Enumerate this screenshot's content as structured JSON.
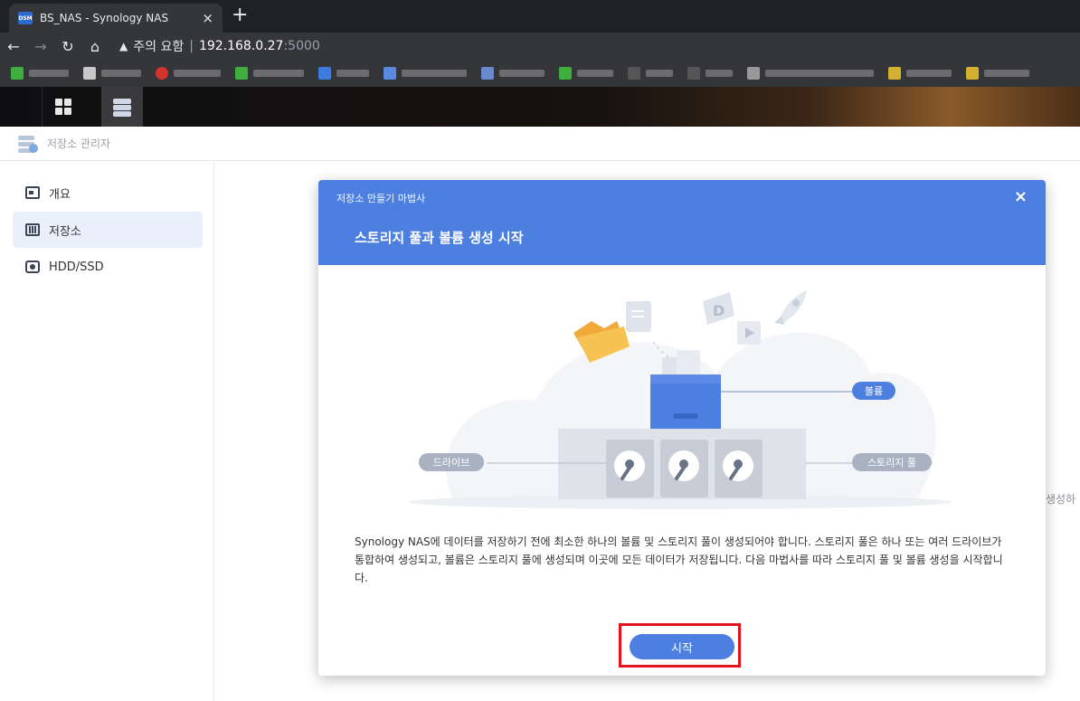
{
  "browser": {
    "tab_favicon": "DSM",
    "tab_title": "BS_NAS - Synology NAS",
    "tab_close": "×",
    "new_tab": "+",
    "warning_icon": "▲",
    "warning_text": "주의 요함",
    "separator": "|",
    "url_host": "192.168.0.27",
    "url_port": ":5000"
  },
  "app": {
    "title": "저장소 관리자"
  },
  "sidebar": {
    "items": [
      {
        "label": "개요"
      },
      {
        "label": "저장소"
      },
      {
        "label": "HDD/SSD"
      }
    ]
  },
  "background": {
    "partial_text": "생성하"
  },
  "modal": {
    "small_title": "저장소 만들기 마법사",
    "close": "×",
    "main_title": "스토리지 풀과 볼륨 생성 시작",
    "labels": {
      "volume": "볼륨",
      "drive": "드라이브",
      "storage_pool": "스토리지 풀"
    },
    "description": "Synology NAS에 데이터를 저장하기 전에 최소한 하나의 볼륨 및 스토리지 풀이 생성되어야 합니다. 스토리지 풀은 하나 또는 여러 드라이브가 통합하여 생성되고, 볼륨은 스토리지 풀에 생성되며 이곳에 모든 데이터가 저장됩니다. 다음 마법사를 따라 스토리지 풀 및 볼륨 생성을 시작합니다.",
    "start_button": "시작"
  },
  "colors": {
    "accent": "#4d7fe0",
    "highlight": "#e3131e"
  }
}
